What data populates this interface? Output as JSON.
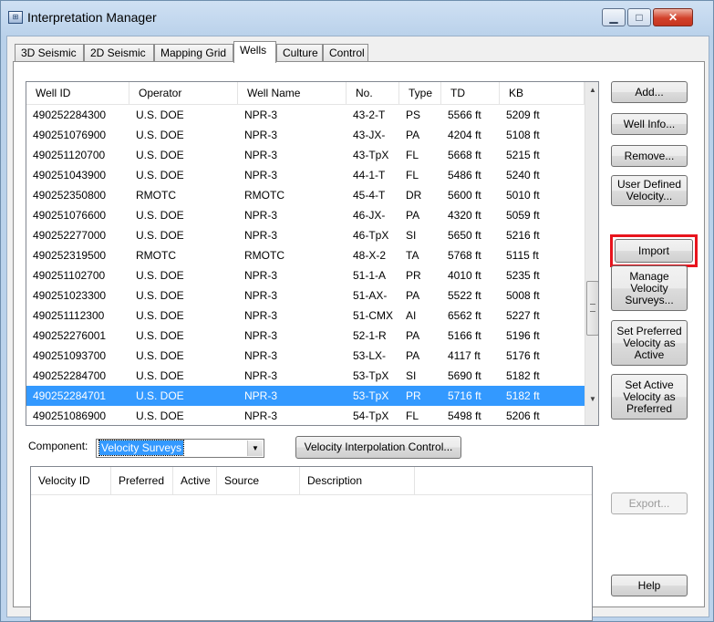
{
  "window": {
    "title": "Interpretation Manager",
    "min_label": "▁",
    "max_label": "□",
    "close_label": "✕"
  },
  "tabs": [
    {
      "label": "3D Seismic"
    },
    {
      "label": "2D Seismic"
    },
    {
      "label": "Mapping Grid"
    },
    {
      "label": "Wells",
      "active": true
    },
    {
      "label": "Culture"
    },
    {
      "label": "Control"
    }
  ],
  "wells_table": {
    "columns": [
      "Well ID",
      "Operator",
      "Well Name",
      "No.",
      "Type",
      "TD",
      "KB"
    ],
    "rows": [
      [
        "490252284300",
        "U.S. DOE",
        "NPR-3",
        "43-2-T",
        "PS",
        "5566 ft",
        "5209 ft"
      ],
      [
        "490251076900",
        "U.S. DOE",
        "NPR-3",
        "43-JX-",
        "PA",
        "4204 ft",
        "5108 ft"
      ],
      [
        "490251120700",
        "U.S. DOE",
        "NPR-3",
        "43-TpX",
        "FL",
        "5668 ft",
        "5215 ft"
      ],
      [
        "490251043900",
        "U.S. DOE",
        "NPR-3",
        "44-1-T",
        "FL",
        "5486 ft",
        "5240 ft"
      ],
      [
        "490252350800",
        "RMOTC",
        "RMOTC",
        "45-4-T",
        "DR",
        "5600 ft",
        "5010 ft"
      ],
      [
        "490251076600",
        "U.S. DOE",
        "NPR-3",
        "46-JX-",
        "PA",
        "4320 ft",
        "5059 ft"
      ],
      [
        "490252277000",
        "U.S. DOE",
        "NPR-3",
        "46-TpX",
        "SI",
        "5650 ft",
        "5216 ft"
      ],
      [
        "490252319500",
        "RMOTC",
        "RMOTC",
        "48-X-2",
        "TA",
        "5768 ft",
        "5115 ft"
      ],
      [
        "490251102700",
        "U.S. DOE",
        "NPR-3",
        "51-1-A",
        "PR",
        "4010 ft",
        "5235 ft"
      ],
      [
        "490251023300",
        "U.S. DOE",
        "NPR-3",
        "51-AX-",
        "PA",
        "5522 ft",
        "5008 ft"
      ],
      [
        "490251112300",
        "U.S. DOE",
        "NPR-3",
        "51-CMX",
        "AI",
        "6562 ft",
        "5227 ft"
      ],
      [
        "490252276001",
        "U.S. DOE",
        "NPR-3",
        "52-1-R",
        "PA",
        "5166 ft",
        "5196 ft"
      ],
      [
        "490251093700",
        "U.S. DOE",
        "NPR-3",
        "53-LX-",
        "PA",
        "4117 ft",
        "5176 ft"
      ],
      [
        "490252284700",
        "U.S. DOE",
        "NPR-3",
        "53-TpX",
        "SI",
        "5690 ft",
        "5182 ft"
      ],
      [
        "490252284701",
        "U.S. DOE",
        "NPR-3",
        "53-TpX",
        "PR",
        "5716 ft",
        "5182 ft"
      ],
      [
        "490251086900",
        "U.S. DOE",
        "NPR-3",
        "54-TpX",
        "FL",
        "5498 ft",
        "5206 ft"
      ]
    ],
    "selected_row": 14
  },
  "buttons": {
    "add": "Add...",
    "well_info": "Well Info...",
    "remove": "Remove...",
    "user_defined_velocity": "User Defined Velocity...",
    "import": "Import",
    "manage_velocity_surveys": "Manage Velocity Surveys...",
    "set_preferred_as_active": "Set Preferred Velocity as Active",
    "set_active_as_preferred": "Set Active Velocity as Preferred",
    "velocity_interpolation_control": "Velocity Interpolation Control...",
    "export": "Export...",
    "help": "Help"
  },
  "component": {
    "label": "Component:",
    "value": "Velocity Surveys"
  },
  "velocity_table": {
    "columns": [
      "Velocity ID",
      "Preferred",
      "Active",
      "Source",
      "Description"
    ]
  },
  "colors": {
    "selection": "#3399ff",
    "highlight_border": "#e8141d"
  },
  "icons": {
    "scroll_up": "▲",
    "scroll_down": "▼",
    "combo_arrow": "▼",
    "app": "⊞"
  }
}
